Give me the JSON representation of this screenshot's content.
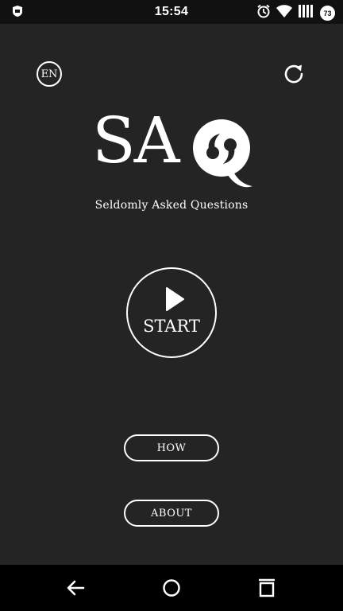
{
  "status_bar": {
    "time": "15:54",
    "battery_level": "73",
    "icons": [
      "notification-icon",
      "alarm-icon",
      "wifi-icon",
      "signal-icon",
      "battery-icon"
    ]
  },
  "header": {
    "language_label": "EN",
    "refresh_icon": "refresh-icon"
  },
  "logo": {
    "text": "SA"
  },
  "subtitle": "Seldomly Asked Questions",
  "start_button": {
    "label": "START",
    "icon": "play-icon"
  },
  "menu": {
    "how_label": "HOW",
    "about_label": "ABOUT"
  },
  "nav_bar": {
    "icons": [
      "back-icon",
      "home-icon",
      "recents-icon"
    ]
  }
}
